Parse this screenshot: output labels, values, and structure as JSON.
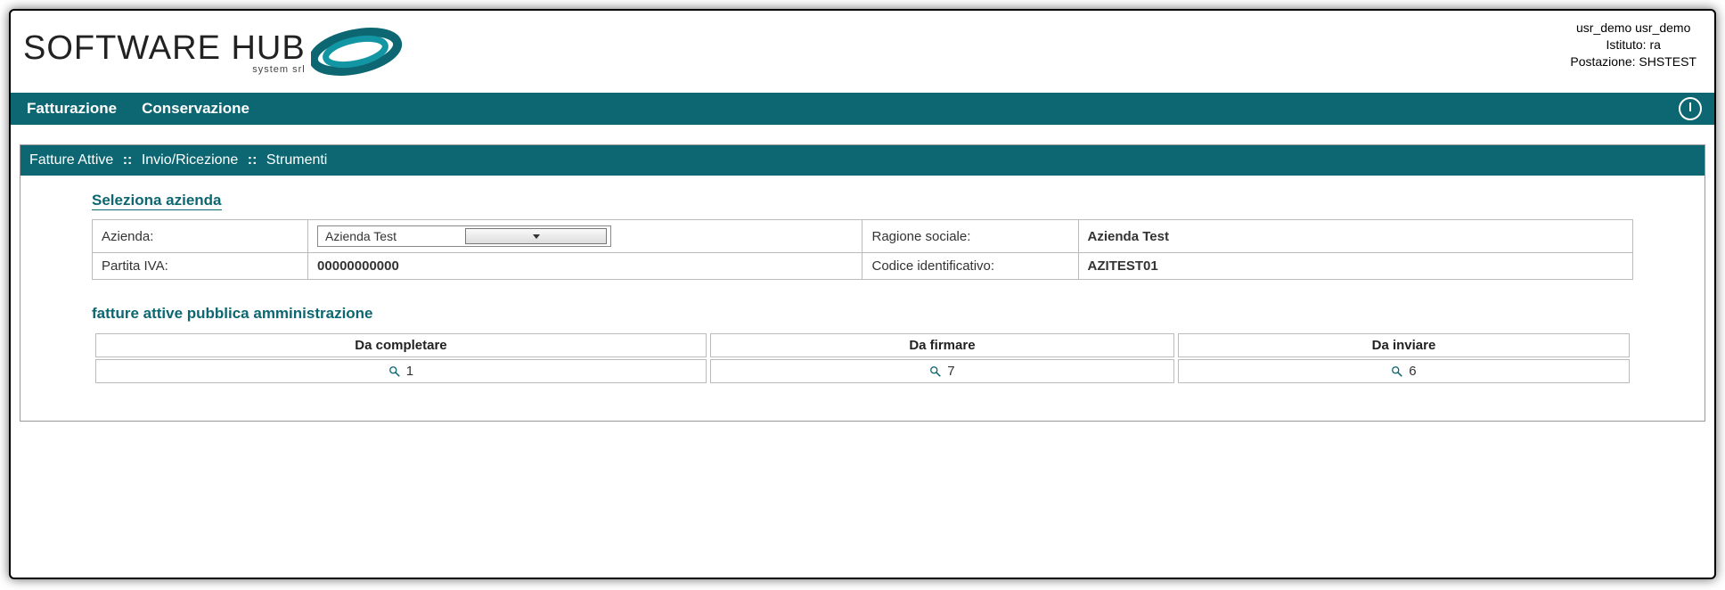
{
  "logo": {
    "line1": "SOFTWARE HUB",
    "line2": "system srl"
  },
  "user": {
    "name": "usr_demo usr_demo",
    "istituto_label": "Istituto:",
    "istituto": "ra",
    "postazione_label": "Postazione:",
    "postazione": "SHSTEST"
  },
  "nav": {
    "items": [
      "Fatturazione",
      "Conservazione"
    ]
  },
  "subnav": {
    "items": [
      "Fatture Attive",
      "Invio/Ricezione",
      "Strumenti"
    ],
    "sep": "::"
  },
  "section1": {
    "title": "Seleziona azienda",
    "labels": {
      "azienda": "Azienda:",
      "ragione": "Ragione sociale:",
      "piva": "Partita IVA:",
      "codice": "Codice identificativo:"
    },
    "values": {
      "azienda_selected": "Azienda Test",
      "ragione": "Azienda Test",
      "piva": "00000000000",
      "codice": "AZITEST01"
    }
  },
  "section2": {
    "title": "fatture attive pubblica amministrazione",
    "cols": [
      {
        "label": "Da completare",
        "count": "1"
      },
      {
        "label": "Da firmare",
        "count": "7"
      },
      {
        "label": "Da inviare",
        "count": "6"
      }
    ]
  }
}
